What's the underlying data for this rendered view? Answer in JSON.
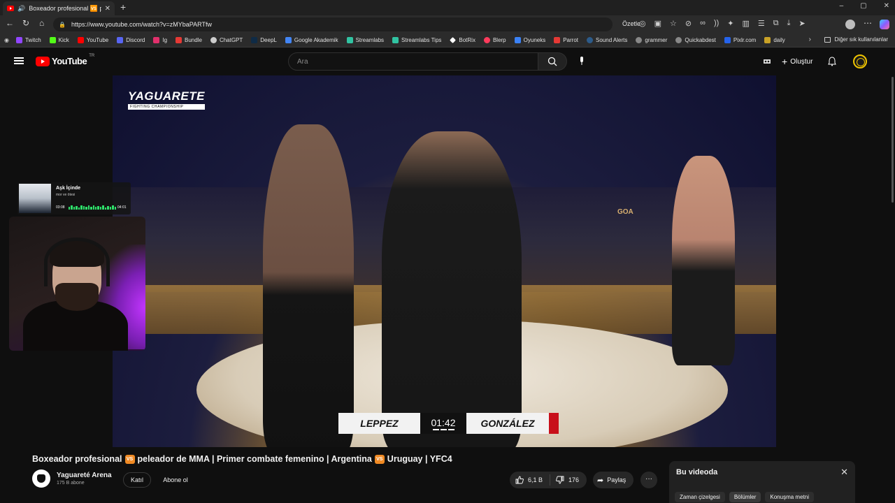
{
  "browser": {
    "tab_title": "Boxeador profesional 🆚 pe",
    "url": "https://www.youtube.com/watch?v=zMYbaPARTfw",
    "summarize_label": "Özetle",
    "window_controls": [
      "–",
      "▢",
      "✕"
    ]
  },
  "bookmarks": [
    {
      "label": "Twitch",
      "color": "#9146ff"
    },
    {
      "label": "Kick",
      "color": "#53fc18"
    },
    {
      "label": "YouTube",
      "color": "#ff0000"
    },
    {
      "label": "Discord",
      "color": "#5865f2"
    },
    {
      "label": "Ig",
      "color": "#e1306c"
    },
    {
      "label": "Bundle",
      "color": "#e53935"
    },
    {
      "label": "ChatGPT",
      "color": "#cccccc"
    },
    {
      "label": "DeepL",
      "color": "#0f2b46"
    },
    {
      "label": "Google Akademik",
      "color": "#4285f4"
    },
    {
      "label": "Streamlabs",
      "color": "#31c3a2"
    },
    {
      "label": "Streamlabs Tips",
      "color": "#31c3a2"
    },
    {
      "label": "BotRix",
      "color": "#ffffff"
    },
    {
      "label": "Blerp",
      "color": "#ff3b5c"
    },
    {
      "label": "Oyuneks",
      "color": "#3b82f6"
    },
    {
      "label": "Parrot",
      "color": "#e53935"
    },
    {
      "label": "Sound Alerts",
      "color": "#2c5b8a"
    },
    {
      "label": "grammer",
      "color": "#888888"
    },
    {
      "label": "Quickabdest",
      "color": "#888888"
    },
    {
      "label": "Pixlr.com",
      "color": "#2563eb"
    },
    {
      "label": "daily",
      "color": "#c9a227"
    }
  ],
  "bookmarks_more": "Diğer sık kullanılanlar",
  "youtube": {
    "logo_text": "YouTube",
    "country_code": "TR",
    "search_placeholder": "Ara",
    "create_label": "Oluştur"
  },
  "video": {
    "org_name": "YAGUARETE",
    "org_subtitle": "FIGHTING CHAMPIONSHIP",
    "fighter_left": "LEPPEZ",
    "fighter_right": "GONZÁLEZ",
    "clock": "01:42",
    "referee_shirt": "GOA"
  },
  "now_playing": {
    "song": "Aşk İçinde",
    "artist": "mor ve ötesi",
    "elapsed": "03:08",
    "total": "04:01"
  },
  "details": {
    "title_parts": [
      "Boxeador profesional",
      "peleador de MMA | Primer combate femenino | Argentina",
      "Uruguay | YFC4"
    ],
    "vs_glyph": "VS",
    "channel_name": "Yaguareté Arena",
    "subscribers": "175 B abone",
    "join_label": "Katıl",
    "subscribe_label": "Abone ol",
    "likes": "6,1 B",
    "dislikes": "176",
    "share_label": "Paylaş",
    "more_label": "···"
  },
  "side_panel": {
    "header": "Bu videoda",
    "tabs": [
      "Zaman çizelgesi",
      "Bölümler",
      "Konuşma metni"
    ],
    "active_tab": "Bölümler"
  },
  "colors": {
    "accent_red": "#ff0000",
    "score_red": "#c8101a",
    "music_green": "#2ee06a",
    "webcam_glow": "#c235ff"
  }
}
